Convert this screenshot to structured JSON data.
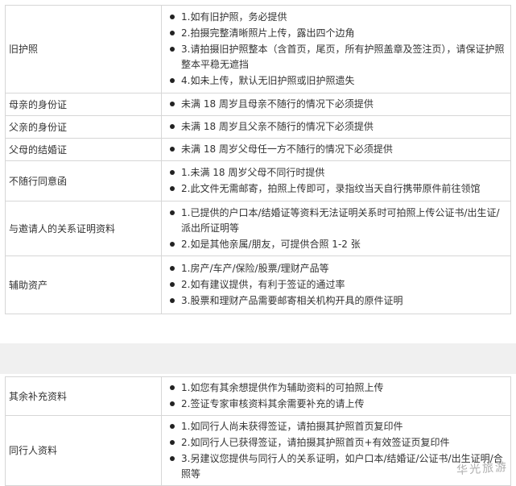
{
  "table1": {
    "rows": [
      {
        "label": "旧护照",
        "items": [
          "1.如有旧护照，务必提供",
          "2.拍摄完整清晰照片上传，露出四个边角",
          "3.请拍摄旧护照整本（含首页，尾页，所有护照盖章及签注页），请保证护照整本平稳无遮挡",
          "4.如未上传，默认无旧护照或旧护照遗失"
        ]
      },
      {
        "label": "母亲的身份证",
        "items": [
          "未满 18 周岁且母亲不随行的情况下必须提供"
        ]
      },
      {
        "label": "父亲的身份证",
        "items": [
          "未满 18 周岁且父亲不随行的情况下必须提供"
        ]
      },
      {
        "label": "父母的结婚证",
        "items": [
          "未满 18 周岁父母任一方不随行的情况下必须提供"
        ]
      },
      {
        "label": "不随行同意函",
        "items": [
          "1.未满 18 周岁父母不同行时提供",
          "2.此文件无需邮寄，拍照上传即可，录指纹当天自行携带原件前往领馆"
        ]
      },
      {
        "label": "与邀请人的关系证明资料",
        "items": [
          "1.已提供的户口本/结婚证等资料无法证明关系时可拍照上传公证书/出生证/派出所证明等",
          "2.如是其他亲属/朋友，可提供合照 1-2 张"
        ]
      },
      {
        "label": "辅助资产",
        "items": [
          "1.房产/车产/保险/股票/理财产品等",
          "2.如有建议提供，有利于签证的通过率",
          "3.股票和理财产品需要邮寄相关机构开具的原件证明"
        ]
      }
    ]
  },
  "table2": {
    "rows": [
      {
        "label": "其余补充资料",
        "items": [
          "1.如您有其余想提供作为辅助资料的可拍照上传",
          "2.签证专家审核资料其余需要补充的请上传"
        ]
      },
      {
        "label": "同行人资料",
        "items": [
          "1.如同行人尚未获得签证，请拍摄其护照首页复印件",
          "2.如同行人已获得签证，请拍摄其护照首页+有效签证页复印件",
          "3.另建议您提供与同行人的关系证明，如户口本/结婚证/公证书/出生证明/合照等"
        ]
      }
    ]
  },
  "watermark": "华光旅游"
}
